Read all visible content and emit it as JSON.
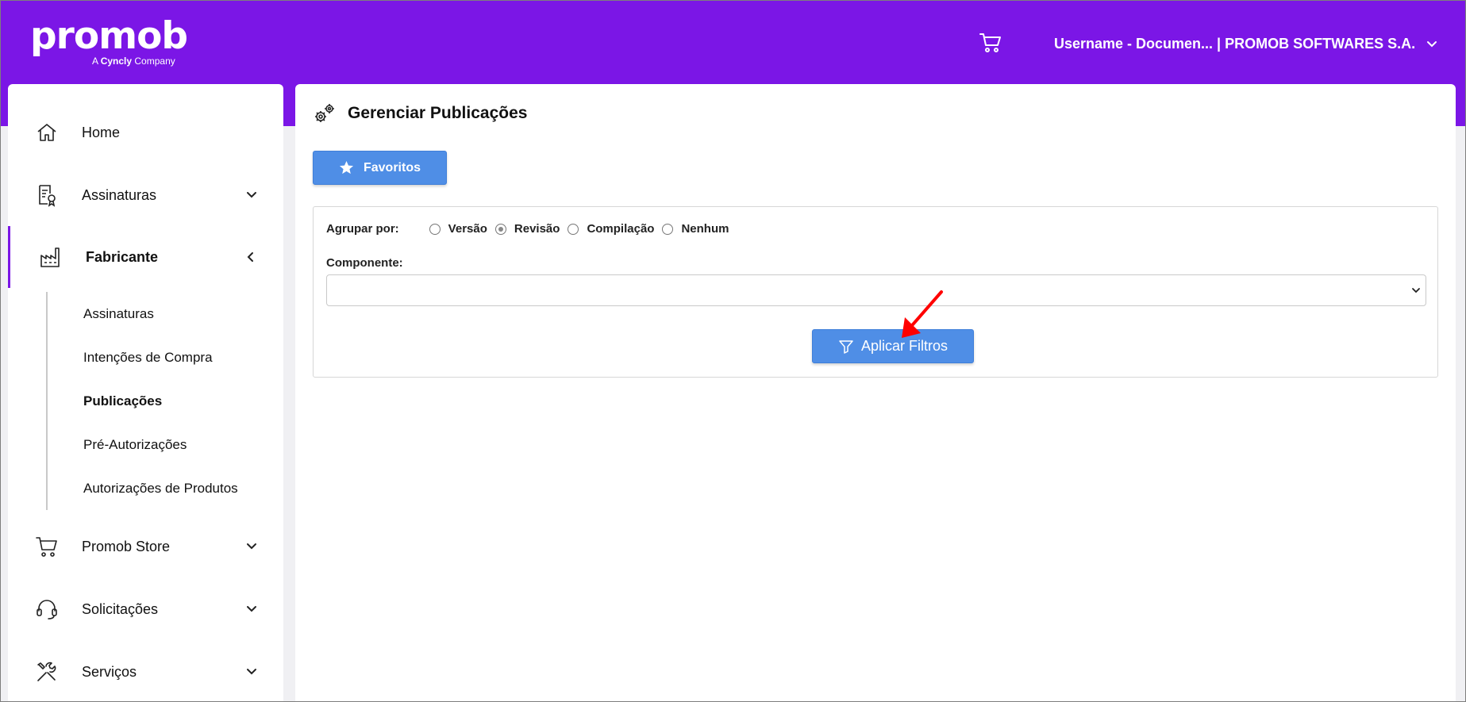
{
  "header": {
    "logo_text": "promob",
    "logo_tagline_prefix": "A",
    "logo_tagline_brand": "Cyncly",
    "logo_tagline_suffix": "Company",
    "cart_icon": "cart-icon",
    "user_label": "Username - Documen... | PROMOB SOFTWARES S.A.",
    "user_chevron_icon": "chevron-down-icon",
    "brand_color": "#7b16e6"
  },
  "sidebar": {
    "items": [
      {
        "label": "Home",
        "icon": "home-icon"
      },
      {
        "label": "Assinaturas",
        "icon": "document-badge-icon",
        "chevron": "chevron-down-icon"
      },
      {
        "label": "Fabricante",
        "icon": "factory-icon",
        "chevron": "chevron-left-icon",
        "active": true
      },
      {
        "label": "Promob Store",
        "icon": "cart-icon",
        "chevron": "chevron-down-icon"
      },
      {
        "label": "Solicitações",
        "icon": "headset-icon",
        "chevron": "chevron-down-icon"
      },
      {
        "label": "Serviços",
        "icon": "tools-icon",
        "chevron": "chevron-down-icon"
      }
    ],
    "subitems": [
      {
        "label": "Assinaturas"
      },
      {
        "label": "Intenções de Compra"
      },
      {
        "label": "Publicações",
        "current": true
      },
      {
        "label": "Pré-Autorizações"
      },
      {
        "label": "Autorizações de Produtos"
      }
    ]
  },
  "main": {
    "title": "Gerenciar Publicações",
    "title_icon": "gears-icon",
    "favorites_label": "Favoritos",
    "favorites_icon": "star-icon",
    "filters": {
      "group_by_label": "Agrupar por:",
      "options": [
        {
          "label": "Versão",
          "checked": false
        },
        {
          "label": "Revisão",
          "checked": true
        },
        {
          "label": "Compilação",
          "checked": false
        },
        {
          "label": "Nenhum",
          "checked": false
        }
      ],
      "component_label": "Componente:",
      "component_value": "",
      "apply_label": "Aplicar Filtros",
      "apply_icon": "filter-icon"
    },
    "button_color": "#4f8ee6",
    "annotation_color": "#ff0000"
  }
}
